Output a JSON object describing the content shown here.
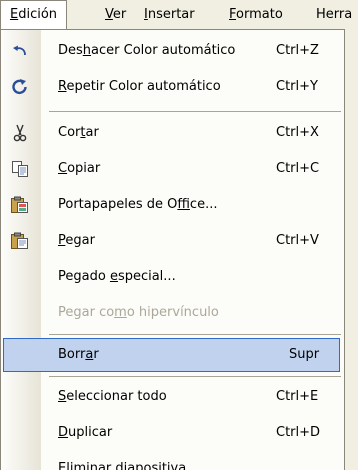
{
  "menubar": {
    "items": [
      {
        "pre": "",
        "acc": "E",
        "post": "dición",
        "active": true
      },
      {
        "pre": "",
        "acc": "V",
        "post": "er",
        "active": false
      },
      {
        "pre": "",
        "acc": "I",
        "post": "nsertar",
        "active": false
      },
      {
        "pre": "",
        "acc": "F",
        "post": "ormato",
        "active": false
      },
      {
        "pre": "",
        "acc": "",
        "post": "Herra",
        "active": false
      }
    ]
  },
  "menu": {
    "items": [
      {
        "pre": "Des",
        "acc": "h",
        "post": "acer Color automático",
        "shortcut": "Ctrl+Z",
        "icon": "undo-icon"
      },
      {
        "pre": "",
        "acc": "R",
        "post": "epetir Color automático",
        "shortcut": "Ctrl+Y",
        "icon": "redo-icon"
      },
      {
        "pre": "Cor",
        "acc": "t",
        "post": "ar",
        "shortcut": "Ctrl+X",
        "icon": "scissors-icon"
      },
      {
        "pre": "",
        "acc": "C",
        "post": "opiar",
        "shortcut": "Ctrl+C",
        "icon": "copy-icon"
      },
      {
        "pre": "Portapapeles de O",
        "acc": "f",
        "post": "fice...",
        "shortcut": "",
        "icon": "office-clipboard-icon"
      },
      {
        "pre": "",
        "acc": "P",
        "post": "egar",
        "shortcut": "Ctrl+V",
        "icon": "paste-icon"
      },
      {
        "pre": "Pegado ",
        "acc": "e",
        "post": "special...",
        "shortcut": "",
        "icon": ""
      },
      {
        "pre": "Pegar co",
        "acc": "m",
        "post": "o hipervínculo",
        "shortcut": "",
        "icon": ""
      },
      {
        "pre": "Borr",
        "acc": "a",
        "post": "r",
        "shortcut": "Supr",
        "icon": ""
      },
      {
        "pre": "",
        "acc": "S",
        "post": "eleccionar todo",
        "shortcut": "Ctrl+E",
        "icon": ""
      },
      {
        "pre": "",
        "acc": "D",
        "post": "uplicar",
        "shortcut": "Ctrl+D",
        "icon": ""
      },
      {
        "pre": "E",
        "acc": "l",
        "post": "iminar diapositiva",
        "shortcut": "",
        "icon": ""
      }
    ]
  },
  "colors": {
    "highlight": "#c1d2ee",
    "highlight_border": "#316ac5",
    "disabled_text": "#aca899"
  }
}
